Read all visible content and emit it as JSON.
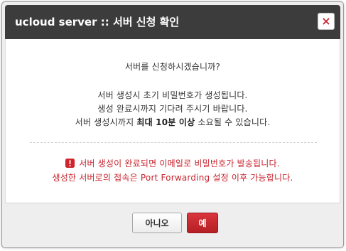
{
  "dialog": {
    "title": "ucloud server :: 서버 신청 확인",
    "close_icon": "close-x-icon",
    "accent_color": "#c8242d"
  },
  "message": {
    "question": "서버를 신청하시겠습니까?",
    "info_line1": "서버 생성시 초기 비밀번호가 생성됩니다.",
    "info_line2": "생성 완료시까지 기다려 주시기 바랍니다.",
    "info_line3_prefix": "서버 생성시까지 ",
    "info_line3_bold": "최대 10분 이상",
    "info_line3_suffix": " 소요될 수 있습니다."
  },
  "warning": {
    "icon": "exclamation-icon",
    "line1": "서버 생성이 완료되면 이메일로 비밀번호가 발송됩니다.",
    "line2": "생성한 서버로의 접속은 Port Forwarding 설정 이후 가능합니다."
  },
  "buttons": {
    "no_label": "아니오",
    "yes_label": "예"
  }
}
